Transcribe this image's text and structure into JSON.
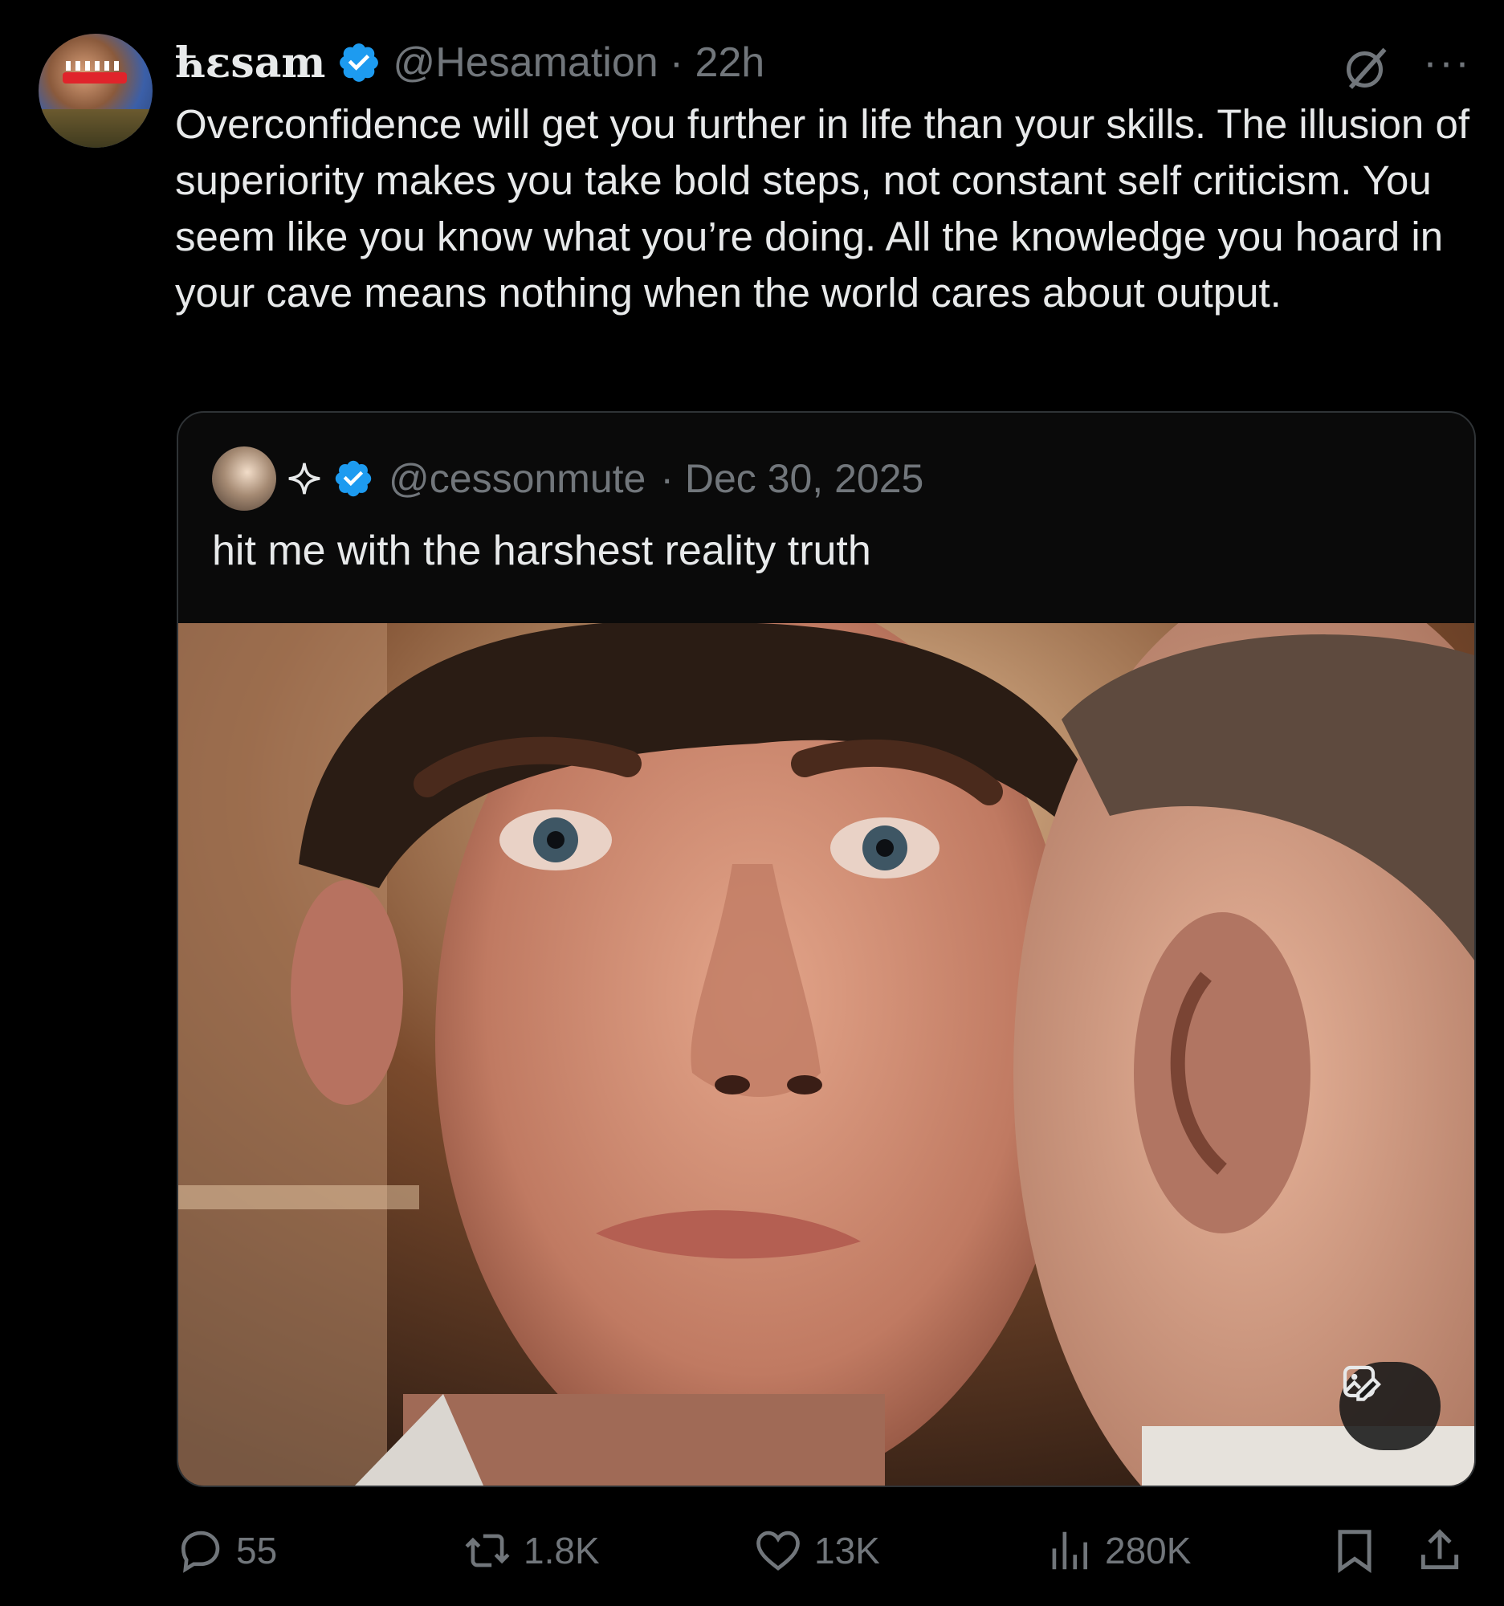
{
  "post": {
    "author_name": "ћεsam",
    "author_handle": "@Hesamation",
    "time": "· 22h",
    "more_label": "···",
    "text": "Overconfidence will get you further in life than your skills. The illusion of superiority makes you take bold steps, not constant self criticism. You seem like you know what you’re doing. All the knowledge you hoard in your cave means nothing when the world cares about output."
  },
  "quote": {
    "author_handle": "@cessonmute",
    "time": "· Dec 30, 2025",
    "text": "hit me with the harshest reality truth"
  },
  "actions": {
    "replies": "55",
    "reposts": "1.8K",
    "likes": "13K",
    "views": "280K"
  },
  "icons": {
    "verified": "verified-badge-icon",
    "grok": "grok-icon",
    "more": "more-icon",
    "sparkle": "sparkle-icon",
    "edit_image": "edit-image-icon",
    "reply": "reply-icon",
    "repost": "repost-icon",
    "like": "heart-icon",
    "views": "analytics-icon",
    "bookmark": "bookmark-icon",
    "share": "share-icon"
  },
  "colors": {
    "background": "#000000",
    "text": "#e7e9ea",
    "secondary": "#71767b",
    "verified": "#1d9bf0",
    "border": "#2f3336"
  }
}
